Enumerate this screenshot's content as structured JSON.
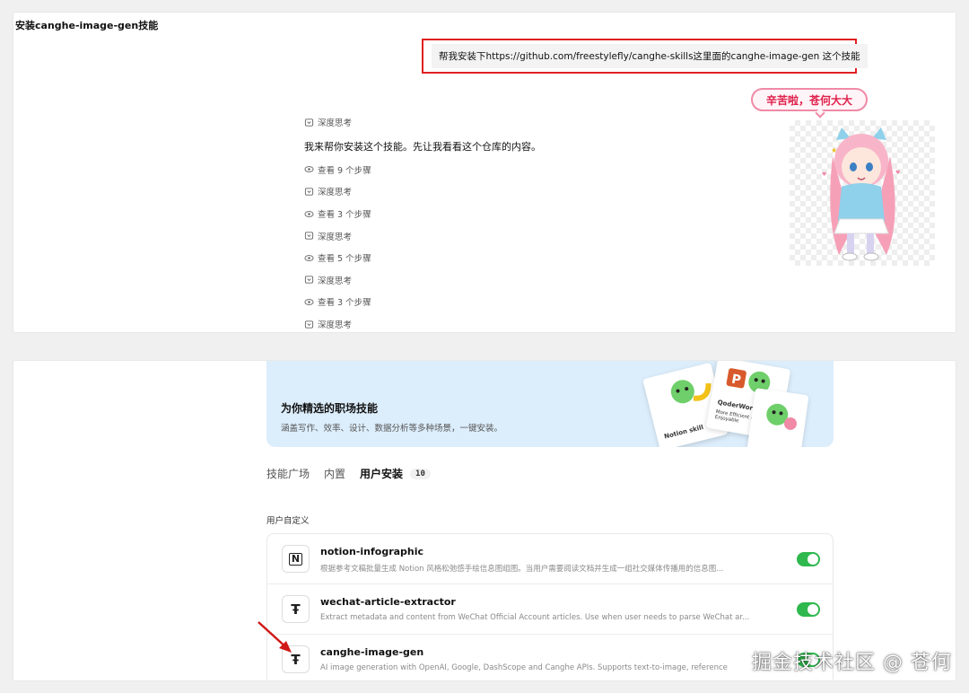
{
  "chat": {
    "title": "安装canghe-image-gen技能",
    "user_message": "帮我安装下https://github.com/freestylefly/canghe-skills这里面的canghe-image-gen 这个技能",
    "answer": "我来帮你安装这个技能。先让我看看这个仓库的内容。",
    "steps": [
      {
        "type": "think",
        "label": "深度思考"
      },
      {
        "type": "answer"
      },
      {
        "type": "view",
        "label": "查看 9 个步骤"
      },
      {
        "type": "think",
        "label": "深度思考"
      },
      {
        "type": "view",
        "label": "查看 3 个步骤"
      },
      {
        "type": "think",
        "label": "深度思考"
      },
      {
        "type": "view",
        "label": "查看 5 个步骤"
      },
      {
        "type": "think",
        "label": "深度思考"
      },
      {
        "type": "view",
        "label": "查看 3 个步骤"
      },
      {
        "type": "think",
        "label": "深度思考"
      }
    ],
    "mascot_bubble": "辛苦啦，苍何大大"
  },
  "skills": {
    "banner": {
      "title": "为你精选的职场技能",
      "subtitle": "涵盖写作、效率、设计、数据分析等多种场景，一键安装。",
      "cards": [
        "Notion skill",
        "QoderWork PPT",
        "More Efficient and Enjoyable"
      ]
    },
    "tabs": [
      {
        "label": "技能广场",
        "active": false
      },
      {
        "label": "内置",
        "active": false
      },
      {
        "label": "用户安装",
        "active": true
      }
    ],
    "installed_count": "10",
    "section_label": "用户自定义",
    "items": [
      {
        "name": "notion-infographic",
        "desc": "根据参考文稿批量生成 Notion 风格松弛感手绘信息图组图。当用户需要阅读文档并生成一组社交媒体传播用的信息图...",
        "icon": "notion-icon",
        "enabled": true
      },
      {
        "name": "wechat-article-extractor",
        "desc": "Extract metadata and content from WeChat Official Account articles. Use when user needs to parse WeChat ar...",
        "icon": "text-tool-icon",
        "enabled": true
      },
      {
        "name": "canghe-image-gen",
        "desc": "AI image generation with OpenAI, Google, DashScope and Canghe APIs. Supports text-to-image, reference",
        "icon": "text-tool-icon",
        "enabled": true
      }
    ]
  },
  "watermark": "掘金技术社区 @ 苍何",
  "colors": {
    "highlight": "#e02020",
    "toggle_on": "#2eb84d",
    "banner_bg": "#dcedfb"
  }
}
